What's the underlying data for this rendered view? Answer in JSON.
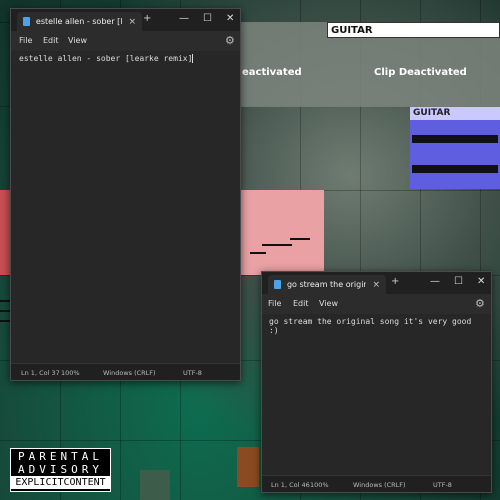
{
  "background": {
    "clip_label_top": "GUITAR",
    "clip_label_blue": "GUITAR",
    "clip_deactivated_1": "Clip Deactivated",
    "clip_deactivated_partial": "eactivated",
    "accent_blue": "#5f5ee0",
    "accent_pink": "#e9a1a3"
  },
  "advisory": {
    "line1": "PARENTAL",
    "line2": "ADVISORY",
    "line3": "EXPLICITCONTENT"
  },
  "window1": {
    "tab_title": "estelle allen - sober [learke",
    "tab_close": "×",
    "new_tab": "+",
    "controls": {
      "minimize": "—",
      "maximize": "☐",
      "close": "✕"
    },
    "menu": {
      "file": "File",
      "edit": "Edit",
      "view": "View"
    },
    "content": "estelle allen - sober [learke remix]",
    "status": {
      "position": "Ln 1, Col 37",
      "zoom": "100%",
      "line_ending": "Windows (CRLF)",
      "encoding": "UTF-8"
    }
  },
  "window2": {
    "tab_title": "go stream the original song",
    "tab_close": "×",
    "new_tab": "+",
    "controls": {
      "minimize": "—",
      "maximize": "☐",
      "close": "✕"
    },
    "menu": {
      "file": "File",
      "edit": "Edit",
      "view": "View"
    },
    "content": "go stream the original song it's very good :)",
    "status": {
      "position": "Ln 1, Col 46",
      "zoom": "100%",
      "line_ending": "Windows (CRLF)",
      "encoding": "UTF-8"
    }
  }
}
